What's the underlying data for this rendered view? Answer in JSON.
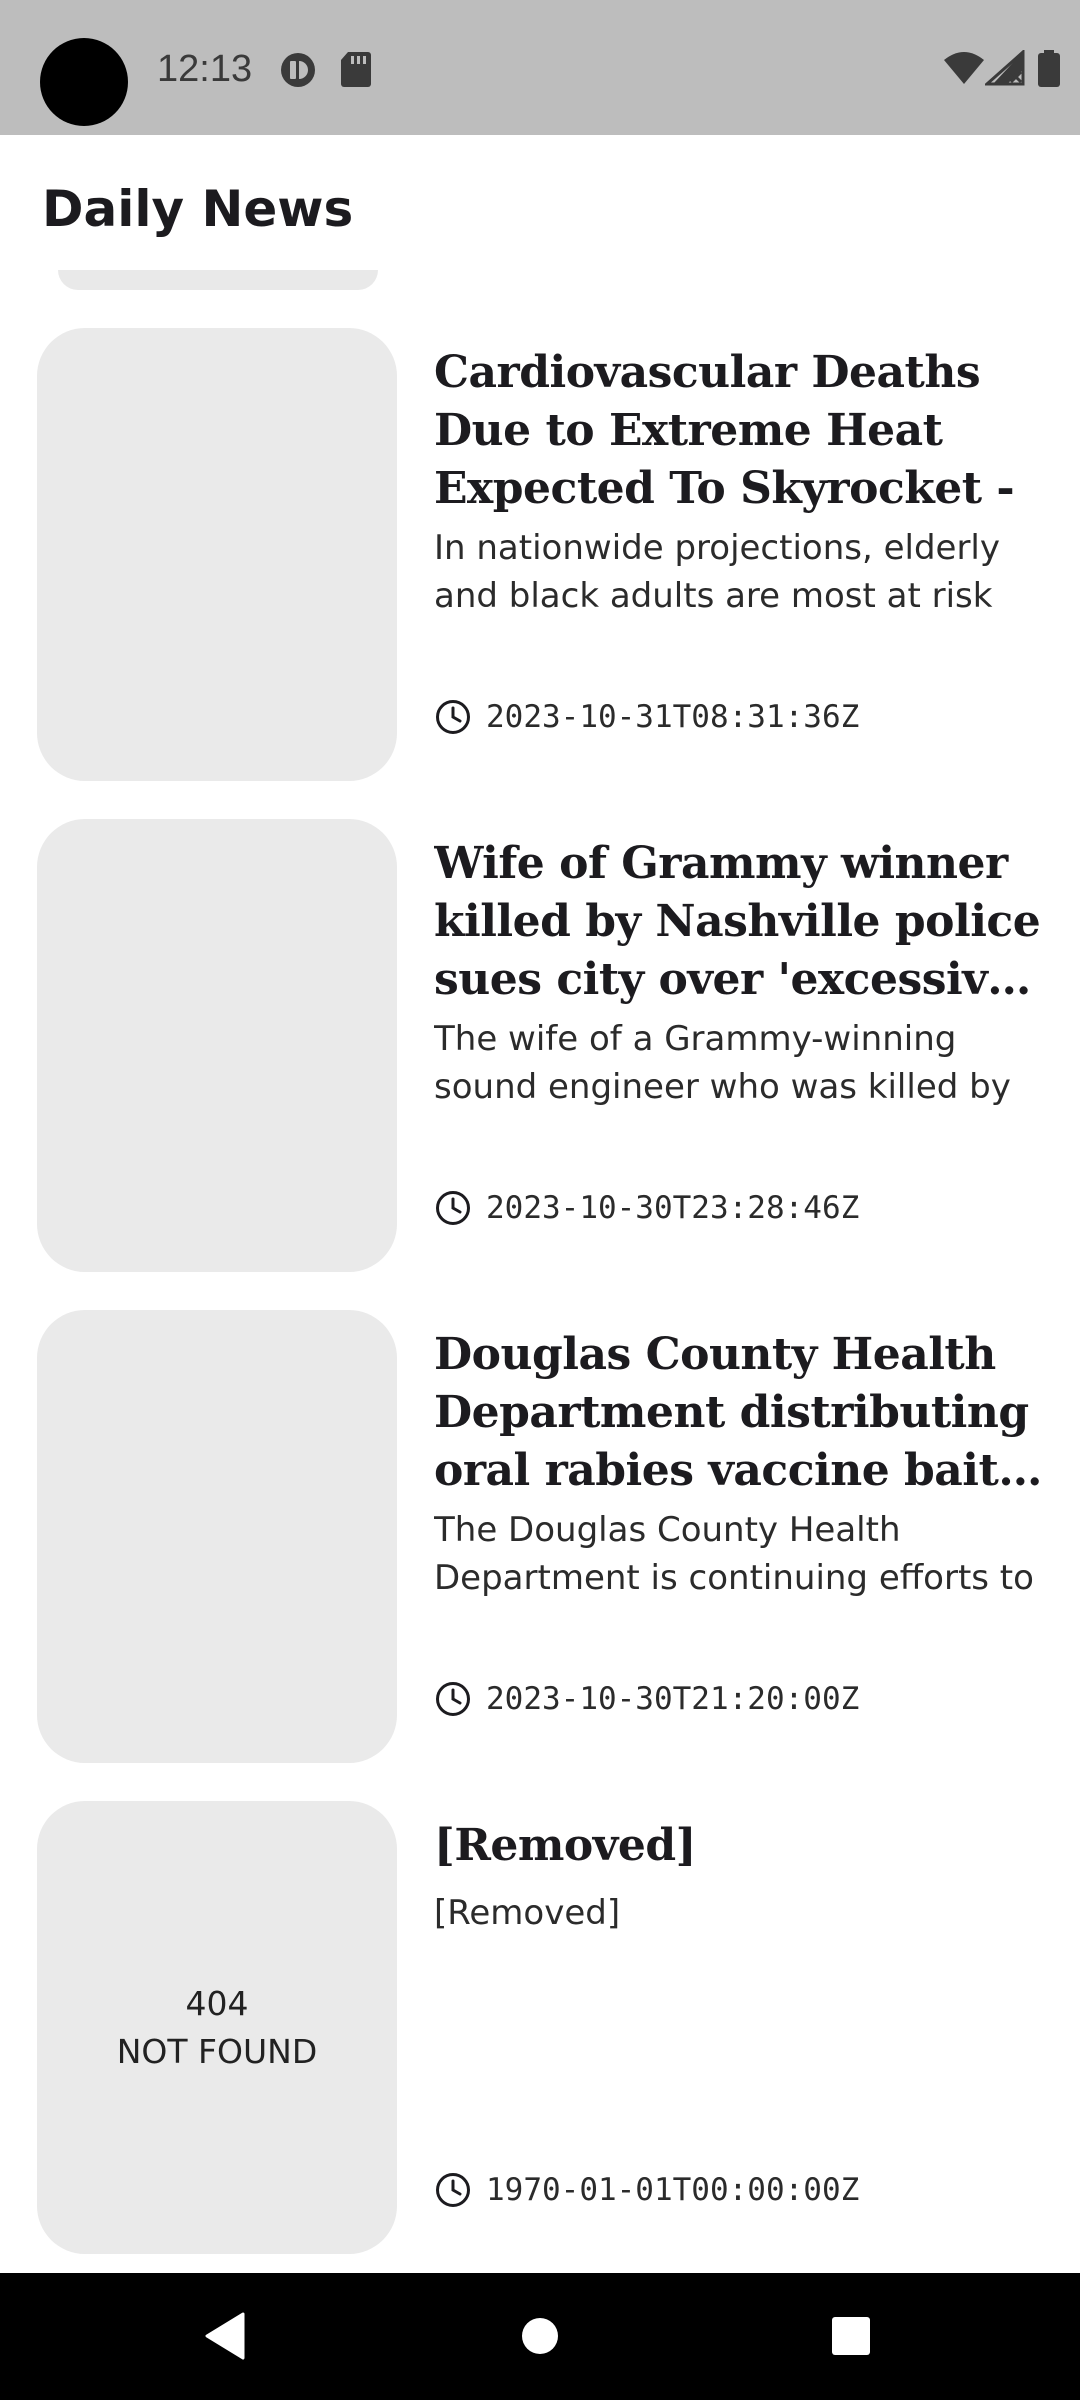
{
  "status_bar": {
    "time": "12:13",
    "left_icons": [
      "private-dns-icon",
      "sd-card-icon"
    ],
    "right_icons": [
      "wifi-icon",
      "cellular-no-signal-icon",
      "battery-icon"
    ]
  },
  "app_bar": {
    "title": "Daily News"
  },
  "articles": [
    {
      "title": "Cardiovascular Deaths Due to Extreme Heat Expected To Skyrocket - SciTechDaily",
      "summary": "In nationwide projections, elderly and black adults are most at risk for",
      "published_at": "2023-10-31T08:31:36Z",
      "image_error": null
    },
    {
      "title": "Wife of Grammy winner killed by Nashville police sues city over 'excessive, ...",
      "summary": "The wife of a Grammy-winning sound engineer who was killed by",
      "published_at": "2023-10-30T23:28:46Z",
      "image_error": null
    },
    {
      "title": "Douglas County Health Department distributing oral rabies vaccine baits t...",
      "summary": "The Douglas County Health Department is continuing efforts to",
      "published_at": "2023-10-30T21:20:00Z",
      "image_error": null
    },
    {
      "title": "[Removed]",
      "summary": "[Removed]",
      "published_at": "1970-01-01T00:00:00Z",
      "image_error": "404\nNOT FOUND"
    }
  ],
  "nav_bar": {
    "buttons": [
      "back-icon",
      "home-icon",
      "recents-icon"
    ]
  },
  "colors": {
    "status_bar_bg": "#bdbdbd",
    "card_placeholder": "#eaeaea",
    "nav_bar_bg": "#000000",
    "text_primary": "#1c1b1f"
  }
}
